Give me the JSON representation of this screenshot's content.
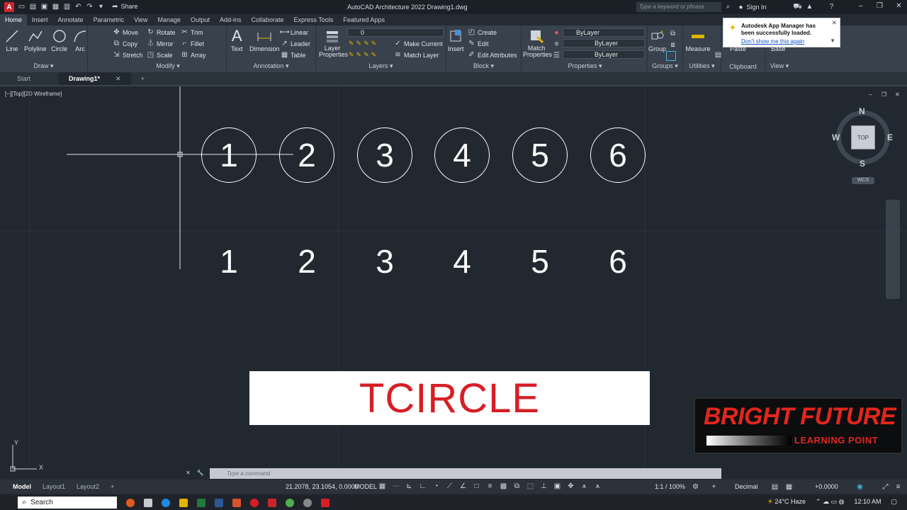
{
  "titlebar": {
    "doc_title": "AutoCAD Architecture 2022    Drawing1.dwg",
    "share": "Share",
    "search_placeholder": "Type a keyword or phrase",
    "sign_in": "Sign In"
  },
  "menu_tabs": [
    "Home",
    "Insert",
    "Annotate",
    "Parametric",
    "View",
    "Manage",
    "Output",
    "Add-ins",
    "Collaborate",
    "Express Tools",
    "Featured Apps"
  ],
  "ribbon": {
    "draw": {
      "title": "Draw",
      "buttons": [
        "Line",
        "Polyline",
        "Circle",
        "Arc"
      ]
    },
    "modify": {
      "title": "Modify",
      "items": [
        "Move",
        "Rotate",
        "Trim",
        "Copy",
        "Mirror",
        "Fillet",
        "Stretch",
        "Scale",
        "Array"
      ]
    },
    "annotation": {
      "title": "Annotation",
      "text": "Text",
      "dimension": "Dimension",
      "linear": "Linear",
      "leader": "Leader",
      "table": "Table"
    },
    "layers": {
      "title": "Layers",
      "layer_properties": "Layer Properties",
      "current_layer": "0",
      "make_current": "Make Current",
      "match_layer": "Match Layer"
    },
    "block": {
      "title": "Block",
      "insert": "Insert",
      "create": "Create",
      "edit": "Edit",
      "edit_attributes": "Edit Attributes"
    },
    "properties": {
      "title": "Properties",
      "match_properties": "Match Properties",
      "bylayer1": "ByLayer",
      "bylayer2": "ByLayer",
      "bylayer3": "ByLayer"
    },
    "groups": {
      "title": "Groups",
      "group": "Group"
    },
    "utilities": {
      "title": "Utilities",
      "measure": "Measure"
    },
    "clipboard": {
      "title": "Clipboard",
      "paste": "Paste"
    },
    "view": {
      "title": "View",
      "base": "Base"
    }
  },
  "file_tabs": [
    "Start",
    "Drawing1*"
  ],
  "viewport": {
    "label": "[−][Top][2D Wireframe]",
    "circle_numbers": [
      "1",
      "2",
      "3",
      "4",
      "5",
      "6"
    ],
    "plain_numbers": [
      "1",
      "2",
      "3",
      "4",
      "5",
      "6"
    ],
    "viewcube": {
      "n": "N",
      "s": "S",
      "e": "E",
      "w": "W",
      "top": "TOP",
      "wcs": "WCS"
    },
    "ucs_y": "Y",
    "ucs_x": "X"
  },
  "overlay": {
    "banner": "TCIRCLE",
    "brand_line1": "BRIGHT FUTURE",
    "brand_line2": "LEARNING POINT"
  },
  "notification": {
    "message": "Autodesk App Manager has been successfully loaded.",
    "link": "Don't show me this again"
  },
  "command": {
    "placeholder": "Type a command"
  },
  "status": {
    "layout_tabs": [
      "Model",
      "Layout1",
      "Layout2"
    ],
    "coords": "21.2078, 23.1054, 0.0000",
    "model": "MODEL",
    "scale": "1:1 / 100%",
    "units": "Decimal",
    "lineweight": "+0.0000"
  },
  "taskbar": {
    "search": "Search",
    "weather": "24°C  Haze",
    "clock": "12:10 AM"
  }
}
